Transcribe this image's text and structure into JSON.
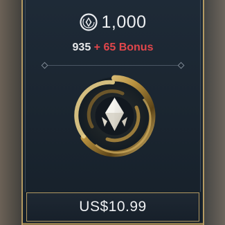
{
  "offer": {
    "total_amount": "1,000",
    "base_amount": "935",
    "bonus_text": "+ 65 Bonus",
    "price": "US$10.99"
  },
  "icons": {
    "currency": "currency-crystal-icon",
    "emblem": "gold-ring-crystal-emblem"
  },
  "colors": {
    "bonus": "#e1464b",
    "gold_border": "#b49a62",
    "card_background": "#1b2631",
    "text": "#eef0f2"
  }
}
